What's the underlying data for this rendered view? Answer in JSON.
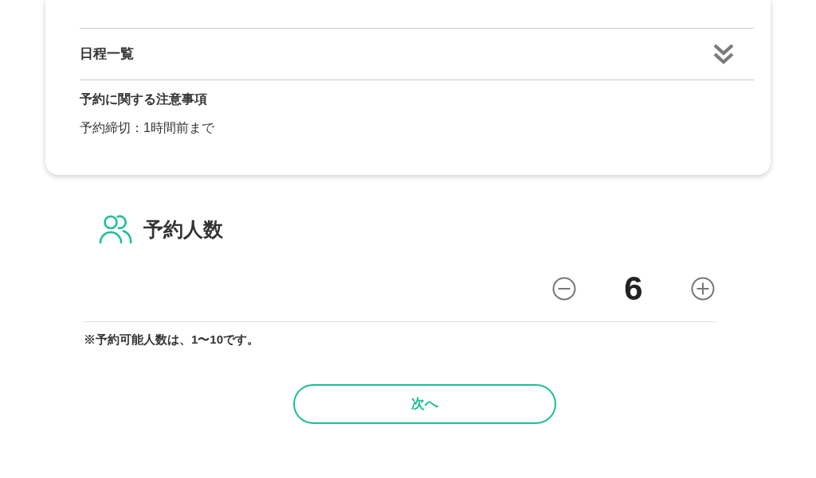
{
  "info_card": {
    "schedule_list": {
      "label": "日程一覧",
      "expanded": false
    },
    "notes": {
      "title": "予約に関する注意事項",
      "text": "予約締切：1時間前まで"
    }
  },
  "party_size": {
    "title": "予約人数",
    "count": "6",
    "note": "※予約可能人数は、1〜10です。"
  },
  "next_button": {
    "label": "次へ"
  }
}
